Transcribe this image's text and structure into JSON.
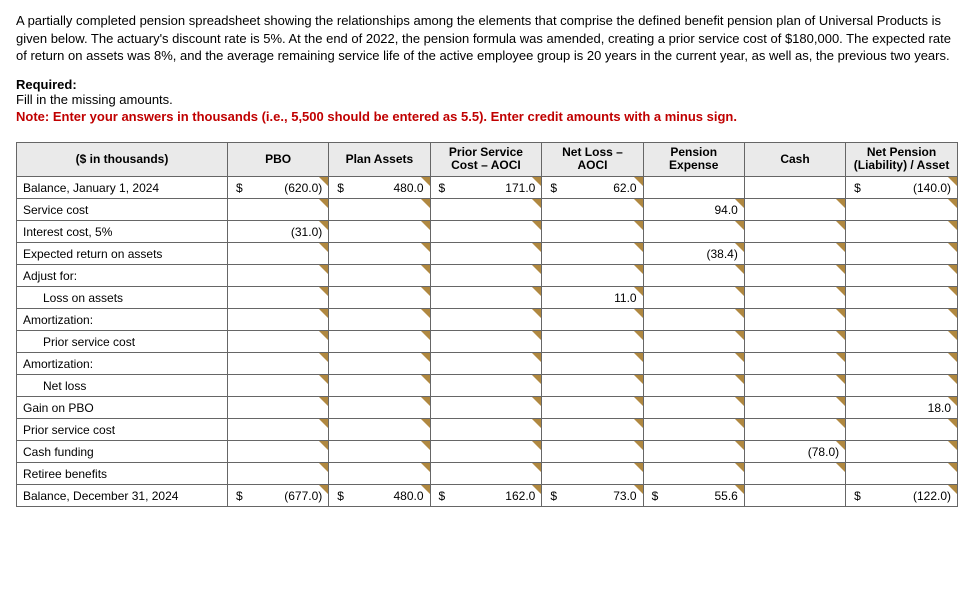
{
  "intro": "A partially completed pension spreadsheet showing the relationships among the elements that comprise the defined benefit pension plan of Universal Products is given below. The actuary's discount rate is 5%. At the end of 2022, the pension formula was amended, creating a prior service cost of $180,000. The expected rate of return on assets was 8%, and the average remaining service life of the active employee group is 20 years in the current year, as well as, the previous two years.",
  "required_label": "Required:",
  "required_text": "Fill in the missing amounts.",
  "note": "Note: Enter your answers in thousands (i.e., 5,500 should be entered as 5.5). Enter credit amounts with a minus sign.",
  "headers": {
    "c0": "($ in thousands)",
    "c1": "PBO",
    "c2": "Plan Assets",
    "c3": "Prior Service Cost – AOCI",
    "c4": "Net Loss – AOCI",
    "c5": "Pension Expense",
    "c6": "Cash",
    "c7": "Net Pension (Liability) / Asset"
  },
  "rows": {
    "r0": {
      "label": "Balance, January 1, 2024",
      "c1s": "$",
      "c1": "(620.0)",
      "c2s": "$",
      "c2": "480.0",
      "c3s": "$",
      "c3": "171.0",
      "c4s": "$",
      "c4": "62.0",
      "c7s": "$",
      "c7": "(140.0)"
    },
    "r1": {
      "label": "Service cost",
      "c5": "94.0"
    },
    "r2": {
      "label": "Interest cost, 5%",
      "c1": "(31.0)"
    },
    "r3": {
      "label": "Expected return on assets",
      "c5": "(38.4)"
    },
    "r4": {
      "label": "Adjust for:"
    },
    "r5": {
      "label": "Loss on assets",
      "c4": "11.0"
    },
    "r6": {
      "label": "Amortization:"
    },
    "r7": {
      "label": "Prior service cost"
    },
    "r8": {
      "label": "Amortization:"
    },
    "r9": {
      "label": "Net loss"
    },
    "r10": {
      "label": "Gain on PBO",
      "c7": "18.0"
    },
    "r11": {
      "label": "Prior service cost"
    },
    "r12": {
      "label": "Cash funding",
      "c6": "(78.0)"
    },
    "r13": {
      "label": "Retiree benefits"
    },
    "r14": {
      "label": "Balance, December 31, 2024",
      "c1s": "$",
      "c1": "(677.0)",
      "c2s": "$",
      "c2": "480.0",
      "c3s": "$",
      "c3": "162.0",
      "c4s": "$",
      "c4": "73.0",
      "c5s": "$",
      "c5": "55.6",
      "c7s": "$",
      "c7": "(122.0)"
    }
  }
}
